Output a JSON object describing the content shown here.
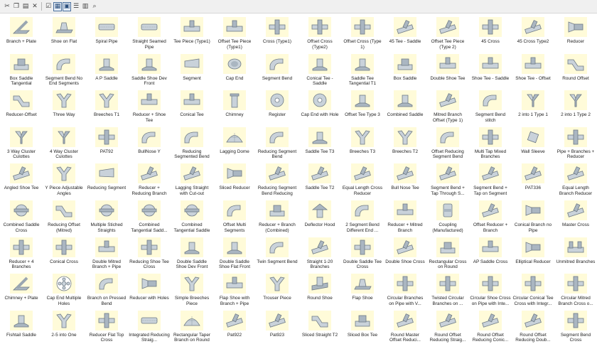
{
  "toolbar": {
    "buttons": [
      {
        "name": "cut-icon",
        "glyph": "✂"
      },
      {
        "name": "copy-icon",
        "glyph": "❐"
      },
      {
        "name": "paste-icon",
        "glyph": "▤"
      },
      {
        "name": "delete-icon",
        "glyph": "✕"
      },
      {
        "name": "properties-icon",
        "glyph": "☑"
      },
      {
        "name": "view-large-icons-icon",
        "glyph": "▦"
      },
      {
        "name": "view-small-icons-icon",
        "glyph": "▣"
      },
      {
        "name": "view-list-icon",
        "glyph": "☰"
      },
      {
        "name": "view-details-icon",
        "glyph": "▥"
      },
      {
        "name": "find-icon",
        "glyph": "⌕"
      }
    ]
  },
  "items": [
    {
      "label": "Branch + Plate",
      "icon": "branch-plate-icon",
      "shape": 0
    },
    {
      "label": "Shoe on Flat",
      "icon": "shoe-on-flat-icon",
      "shape": 1
    },
    {
      "label": "Spiral Pipe",
      "icon": "spiral-pipe-icon",
      "shape": 2
    },
    {
      "label": "Straight Seamed Pipe",
      "icon": "straight-seamed-pipe-icon",
      "shape": 2
    },
    {
      "label": "Tee Piece (Type1)",
      "icon": "tee-piece-icon",
      "shape": 3
    },
    {
      "label": "Offset Tee Piece (Type1)",
      "icon": "offset-tee-piece-icon",
      "shape": 3
    },
    {
      "label": "Cross (Type1)",
      "icon": "cross-icon",
      "shape": 4
    },
    {
      "label": "Offset Cross (Type2)",
      "icon": "offset-cross-icon",
      "shape": 4
    },
    {
      "label": "Offset Cross (Type 1)",
      "icon": "offset-cross-type1-icon",
      "shape": 4
    },
    {
      "label": "45 Tee - Saddle",
      "icon": "tee-saddle-45-icon",
      "shape": 5
    },
    {
      "label": "Offset Tee Piece (Type 2)",
      "icon": "offset-tee-piece-type2-icon",
      "shape": 5
    },
    {
      "label": "45 Cross",
      "icon": "cross-45-icon",
      "shape": 4
    },
    {
      "label": "45 Cross Type2",
      "icon": "cross-45-type2-icon",
      "shape": 5
    },
    {
      "label": "Reducer",
      "icon": "reducer-icon",
      "shape": 6
    },
    {
      "label": "Box Saddle Tangential",
      "icon": "box-saddle-tangential-icon",
      "shape": 7
    },
    {
      "label": "Segment Bend No End Segments",
      "icon": "segment-bend-no-end-icon",
      "shape": 8
    },
    {
      "label": "A P Saddle",
      "icon": "ap-saddle-icon",
      "shape": 9
    },
    {
      "label": "Saddle Shoe Dev Front",
      "icon": "saddle-shoe-dev-front-icon",
      "shape": 9
    },
    {
      "label": "Segment",
      "icon": "segment-icon",
      "shape": 10
    },
    {
      "label": "Cap End",
      "icon": "cap-end-icon",
      "shape": 11
    },
    {
      "label": "Segment Bend",
      "icon": "segment-bend-icon",
      "shape": 8
    },
    {
      "label": "Conical Tee - Saddle",
      "icon": "conical-tee-saddle-icon",
      "shape": 9
    },
    {
      "label": "Saddle Tee Tangential T1",
      "icon": "saddle-tee-tangential-icon",
      "shape": 9
    },
    {
      "label": "Box Saddle",
      "icon": "box-saddle-icon",
      "shape": 7
    },
    {
      "label": "Double Shoe Tee",
      "icon": "double-shoe-tee-icon",
      "shape": 3
    },
    {
      "label": "Shoe Tee - Saddle",
      "icon": "shoe-tee-saddle-icon",
      "shape": 3
    },
    {
      "label": "Shoe Tee - Offset",
      "icon": "shoe-tee-offset-icon",
      "shape": 3
    },
    {
      "label": "Round Offset",
      "icon": "round-offset-icon",
      "shape": 12
    },
    {
      "label": "Reducer-Offset",
      "icon": "reducer-offset-icon",
      "shape": 12
    },
    {
      "label": "Three Way",
      "icon": "three-way-icon",
      "shape": 13
    },
    {
      "label": "Breeches T1",
      "icon": "breeches-t1-icon",
      "shape": 13
    },
    {
      "label": "Reducer + Shoe Tee",
      "icon": "reducer-shoe-tee-icon",
      "shape": 3
    },
    {
      "label": "Conical Tee",
      "icon": "conical-tee-icon",
      "shape": 3
    },
    {
      "label": "Chimney",
      "icon": "chimney-icon",
      "shape": 14
    },
    {
      "label": "Register",
      "icon": "register-icon",
      "shape": 15
    },
    {
      "label": "Cap End with Hole",
      "icon": "cap-end-hole-icon",
      "shape": 15
    },
    {
      "label": "Offset Tee Type 3",
      "icon": "offset-tee-type3-icon",
      "shape": 9
    },
    {
      "label": "Combined Saddle",
      "icon": "combined-saddle-icon",
      "shape": 9
    },
    {
      "label": "Mitred Branch Offset (Type 1)",
      "icon": "mitred-branch-offset-icon",
      "shape": 5
    },
    {
      "label": "Segment Bend stitch",
      "icon": "segment-bend-stitch-icon",
      "shape": 8
    },
    {
      "label": "2 into 1 Type 1",
      "icon": "two-into-one-type1-icon",
      "shape": 16
    },
    {
      "label": "2 into 1 Type 2",
      "icon": "two-into-one-type2-icon",
      "shape": 16
    },
    {
      "label": "3 Way Cluster Culottes",
      "icon": "three-way-cluster-icon",
      "shape": 16
    },
    {
      "label": "4 Way Cluster Culottes",
      "icon": "four-way-cluster-icon",
      "shape": 16
    },
    {
      "label": "PAT92",
      "icon": "pat92-icon",
      "shape": 4
    },
    {
      "label": "BullNose Y",
      "icon": "bullnose-y-icon",
      "shape": 8
    },
    {
      "label": "Reducing Segmented Bend",
      "icon": "reducing-segmented-bend-icon",
      "shape": 8
    },
    {
      "label": "Lagging Dome",
      "icon": "lagging-dome-icon",
      "shape": 17
    },
    {
      "label": "Reducing Segment Bend",
      "icon": "reducing-segment-bend-icon",
      "shape": 8
    },
    {
      "label": "Saddle Tee T3",
      "icon": "saddle-tee-t3-icon",
      "shape": 9
    },
    {
      "label": "Breeches T3",
      "icon": "breeches-t3-icon",
      "shape": 13
    },
    {
      "label": "Breeches T2",
      "icon": "breeches-t2-icon",
      "shape": 13
    },
    {
      "label": "Offset Reducing Segment Bend",
      "icon": "offset-reducing-segment-bend-icon",
      "shape": 8
    },
    {
      "label": "Multi Tap Mixed Branches",
      "icon": "multi-tap-mixed-icon",
      "shape": 4
    },
    {
      "label": "Wall Sleeve",
      "icon": "wall-sleeve-icon",
      "shape": 18
    },
    {
      "label": "Pipe + Branches + Reducer",
      "icon": "pipe-branches-reducer-icon",
      "shape": 4
    },
    {
      "label": "Angled Shoe Tee",
      "icon": "angled-shoe-tee-icon",
      "shape": 5
    },
    {
      "label": "Y Piece Adjustable Angles",
      "icon": "y-piece-adjustable-icon",
      "shape": 13
    },
    {
      "label": "Reducing Segment",
      "icon": "reducing-segment-icon",
      "shape": 10
    },
    {
      "label": "Reducer + Reducing Branch",
      "icon": "reducer-reducing-branch-icon",
      "shape": 5
    },
    {
      "label": "Lagging Straight with Cut-out",
      "icon": "lagging-straight-icon",
      "shape": 5
    },
    {
      "label": "Sliced Reducer",
      "icon": "sliced-reducer-icon",
      "shape": 6
    },
    {
      "label": "Reducing Segment Bend Reducing En...",
      "icon": "reducing-segment-bend-end-icon",
      "shape": 5
    },
    {
      "label": "Saddle Tee T2",
      "icon": "saddle-tee-t2-icon",
      "shape": 5
    },
    {
      "label": "Equal Length Cross Reducer",
      "icon": "equal-length-cross-reducer-icon",
      "shape": 5
    },
    {
      "label": "Bull Nose Tee",
      "icon": "bull-nose-tee-icon",
      "shape": 5
    },
    {
      "label": "Segment Bend + Tap Through S...",
      "icon": "segment-bend-tap-through-icon",
      "shape": 5
    },
    {
      "label": "Segment Bend + Tap on Segment",
      "icon": "segment-bend-tap-segment-icon",
      "shape": 5
    },
    {
      "label": "PAT336",
      "icon": "pat336-icon",
      "shape": 5
    },
    {
      "label": "Equal Length Branch Reducer",
      "icon": "equal-length-branch-reducer-icon",
      "shape": 5
    },
    {
      "label": "Combined Saddle Cross",
      "icon": "combined-saddle-cross-icon",
      "shape": 19
    },
    {
      "label": "Reducing Offset (Mitred)",
      "icon": "reducing-offset-mitred-icon",
      "shape": 12
    },
    {
      "label": "Multiple Stiched Straights",
      "icon": "multiple-stiched-straights-icon",
      "shape": 19
    },
    {
      "label": "Combined Tangential Sadd...",
      "icon": "combined-tangential-saddle-icon",
      "shape": 19
    },
    {
      "label": "Combined Tangential Saddle",
      "icon": "combined-tangential-saddle-2-icon",
      "shape": 19
    },
    {
      "label": "Offset Multi Segments",
      "icon": "offset-multi-segments-icon",
      "shape": 8
    },
    {
      "label": "Reducer + Branch (Combined)",
      "icon": "reducer-branch-combined-icon",
      "shape": 7
    },
    {
      "label": "Deflector Hood",
      "icon": "deflector-hood-icon",
      "shape": 20
    },
    {
      "label": "2 Segment Bend Different End ...",
      "icon": "two-segment-bend-icon",
      "shape": 8
    },
    {
      "label": "Reducer + Mitred Branch",
      "icon": "reducer-mitred-branch-icon",
      "shape": 3
    },
    {
      "label": "Coupling (Manufactured)",
      "icon": "coupling-icon",
      "shape": 21
    },
    {
      "label": "Offset Reducer + Branch",
      "icon": "offset-reducer-branch-icon",
      "shape": 5
    },
    {
      "label": "Conical Branch no Pipe",
      "icon": "conical-branch-no-pipe-icon",
      "shape": 6
    },
    {
      "label": "Master Cross",
      "icon": "master-cross-icon",
      "shape": 5
    },
    {
      "label": "Reducer + 4 Branches",
      "icon": "reducer-four-branches-icon",
      "shape": 4
    },
    {
      "label": "Conical Cross",
      "icon": "conical-cross-icon",
      "shape": 4
    },
    {
      "label": "Double Mitred Branch + Pipe",
      "icon": "double-mitred-branch-icon",
      "shape": 3
    },
    {
      "label": "Reducing Shoe Tee Cross",
      "icon": "reducing-shoe-tee-cross-icon",
      "shape": 4
    },
    {
      "label": "Double Saddle Shoe Dev Front",
      "icon": "double-saddle-shoe-icon",
      "shape": 9
    },
    {
      "label": "Double Saddle Shoe Flat Front",
      "icon": "double-saddle-shoe-flat-icon",
      "shape": 9
    },
    {
      "label": "Twin Segment Bend",
      "icon": "twin-segment-bend-icon",
      "shape": 8
    },
    {
      "label": "Straight 1-20 Branches",
      "icon": "straight-branches-icon",
      "shape": 5
    },
    {
      "label": "Double Saddle Tee Cross",
      "icon": "double-saddle-tee-cross-icon",
      "shape": 4
    },
    {
      "label": "Double Shoe Cross",
      "icon": "double-shoe-cross-icon",
      "shape": 5
    },
    {
      "label": "Rectangular Cross on Round",
      "icon": "rectangular-cross-icon",
      "shape": 7
    },
    {
      "label": "AP Saddle Cross",
      "icon": "ap-saddle-cross-icon",
      "shape": 3
    },
    {
      "label": "Elliptical Reducer",
      "icon": "elliptical-reducer-icon",
      "shape": 6
    },
    {
      "label": "Unmitred Branches",
      "icon": "unmitred-branches-icon",
      "shape": 22
    },
    {
      "label": "Chimney + Plate",
      "icon": "chimney-plate-icon",
      "shape": 0
    },
    {
      "label": "Cap End Multiple Holes",
      "icon": "cap-end-multiple-holes-icon",
      "shape": 23
    },
    {
      "label": "Branch on Pressed Bend",
      "icon": "branch-pressed-bend-icon",
      "shape": 8
    },
    {
      "label": "Reducer with Holes",
      "icon": "reducer-holes-icon",
      "shape": 6
    },
    {
      "label": "Simple Breeches Piece",
      "icon": "simple-breeches-icon",
      "shape": 13
    },
    {
      "label": "Flap Shoe with Branch + Pipe",
      "icon": "flap-shoe-branch-icon",
      "shape": 3
    },
    {
      "label": "Trouser Piece",
      "icon": "trouser-piece-icon",
      "shape": 13
    },
    {
      "label": "Round Shoe",
      "icon": "round-shoe-icon",
      "shape": 24
    },
    {
      "label": "Flap Shoe",
      "icon": "flap-shoe-icon",
      "shape": 1
    },
    {
      "label": "Circular Branches on Pipe with V...",
      "icon": "circular-branches-v-icon",
      "shape": 4
    },
    {
      "label": "Twisted Circular Branches on ...",
      "icon": "twisted-circular-branches-icon",
      "shape": 4
    },
    {
      "label": "Circular Shoe Cross on Pipe with Inte...",
      "icon": "circular-shoe-cross-icon",
      "shape": 4
    },
    {
      "label": "Circular Conical Tee Cross with Integr...",
      "icon": "circular-conical-tee-cross-icon",
      "shape": 4
    },
    {
      "label": "Circular Mitred Branch Cross o...",
      "icon": "circular-mitred-branch-cross-icon",
      "shape": 4
    },
    {
      "label": "Fishtail Saddle",
      "icon": "fishtail-saddle-icon",
      "shape": 9
    },
    {
      "label": "2-5 into One",
      "icon": "two-five-into-one-icon",
      "shape": 13
    },
    {
      "label": "Reducer Flat Top Cross",
      "icon": "reducer-flat-top-cross-icon",
      "shape": 4
    },
    {
      "label": "Integrated Reducing Straig...",
      "icon": "integrated-reducing-straight-icon",
      "shape": 2
    },
    {
      "label": "Rectangular Taper Branch on Round",
      "icon": "rectangular-taper-branch-icon",
      "shape": 17
    },
    {
      "label": "Pat922",
      "icon": "pat922-icon",
      "shape": 5
    },
    {
      "label": "Pat923",
      "icon": "pat923-icon",
      "shape": 5
    },
    {
      "label": "Sliced Straight T2",
      "icon": "sliced-straight-t2-icon",
      "shape": 12
    },
    {
      "label": "Sliced Box Tee",
      "icon": "sliced-box-tee-icon",
      "shape": 7
    },
    {
      "label": "Round Master Offset Reduci...",
      "icon": "round-master-offset-icon",
      "shape": 5
    },
    {
      "label": "Round Offset Reducing Straig...",
      "icon": "round-offset-reducing-straight-icon",
      "shape": 5
    },
    {
      "label": "Round Offset Reducing Conic...",
      "icon": "round-offset-reducing-conical-icon",
      "shape": 5
    },
    {
      "label": "Round Offset Reducing Doub...",
      "icon": "round-offset-reducing-double-icon",
      "shape": 5
    },
    {
      "label": "Segment Bend Cross",
      "icon": "segment-bend-cross-icon",
      "shape": 4
    }
  ]
}
